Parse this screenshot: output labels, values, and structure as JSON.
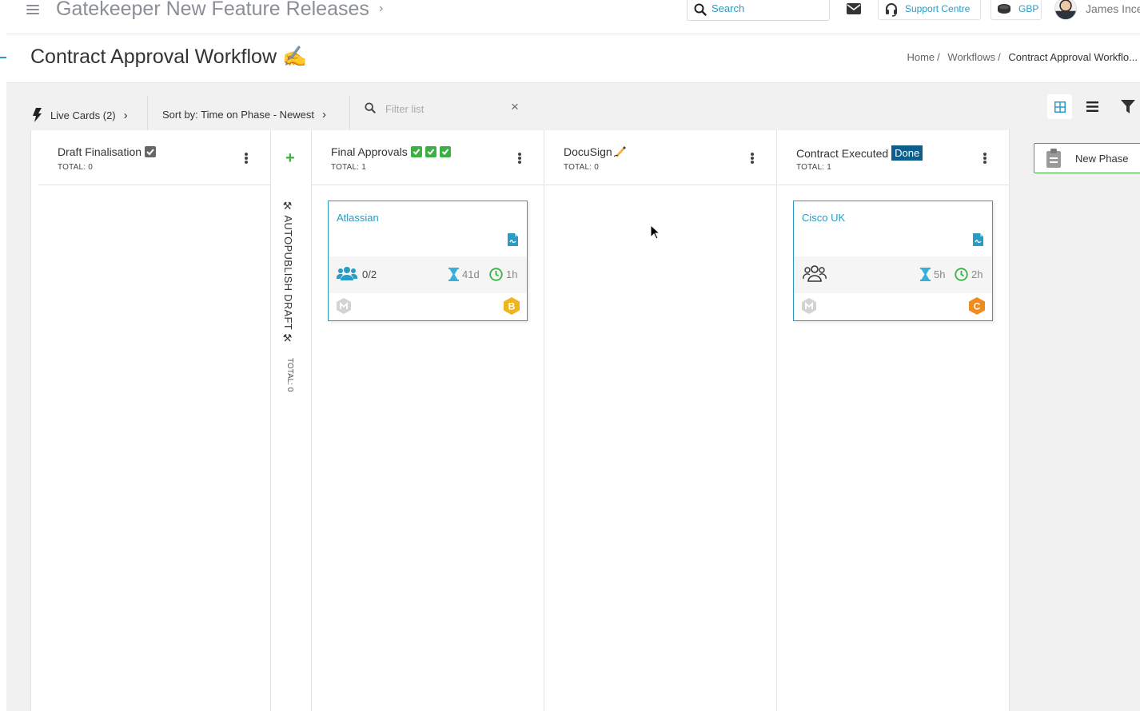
{
  "app": {
    "title": "Gatekeeper New Feature Releases",
    "title_chevron": "›"
  },
  "header": {
    "search_placeholder": "Search",
    "support_label": "Support Centre",
    "currency_label": "GBP",
    "user_name": "James Ince"
  },
  "page": {
    "title": "Contract Approval Workflow ✍️",
    "breadcrumb": [
      {
        "label": "Home",
        "sep": "/"
      },
      {
        "label": "Workflows",
        "sep": "/"
      },
      {
        "label": "Contract Approval Workflo..."
      }
    ]
  },
  "toolbar": {
    "live_cards": "Live Cards (2)",
    "sort_by": "Sort by: Time on Phase - Newest",
    "chevron": "›",
    "filter_placeholder": "Filter list",
    "clear": "×"
  },
  "columns": [
    {
      "name": "Draft Finalisation",
      "total": "TOTAL: 0"
    },
    {
      "name": "Final Approvals",
      "total": "TOTAL: 1"
    },
    {
      "name": "DocuSign",
      "total": "TOTAL: 0"
    },
    {
      "name": "Contract Executed",
      "badge": "Done",
      "total": "TOTAL: 1"
    }
  ],
  "collapsed_phase": {
    "add": "+",
    "label": "⚒ AUTOPUBLISH DRAFT ⚒",
    "total": "TOTAL: 0"
  },
  "cards": [
    {
      "title": "Atlassian",
      "approvers": "0/2",
      "time_in_phase": "41d",
      "time_other": "1h",
      "badge_letter": "B",
      "badge_color": "#f0b51e"
    },
    {
      "title": "Cisco UK",
      "approvers": "",
      "time_in_phase": "5h",
      "time_other": "2h",
      "badge_letter": "C",
      "badge_color": "#f08c1e"
    }
  ],
  "new_phase": {
    "label": "New Phase"
  },
  "colors": {
    "accent": "#2a9bc4",
    "green": "#3db044",
    "done": "#0b5f8a"
  }
}
